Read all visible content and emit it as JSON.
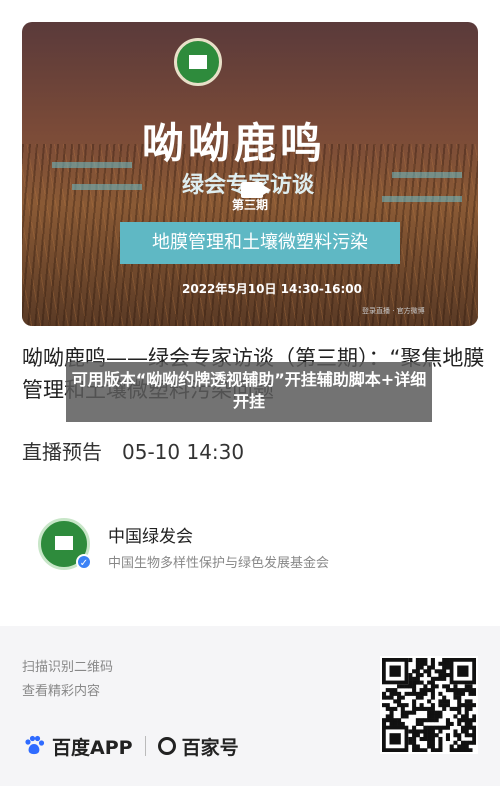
{
  "cover": {
    "title_art": "呦呦鹿鸣",
    "subtitle": "绿会专家访谈",
    "episode": "第三期",
    "topic": "地膜管理和土壤微塑料污染",
    "datetime": "2022年5月10日 14:30-16:00",
    "tiny_text": "登录直播 · 官方微博"
  },
  "headline": "呦呦鹿鸣——绿会专家访谈（第三期）：“聚焦地膜管理和土壤微塑料污染问题",
  "overlay_text": "可用版本“呦呦约牌透视辅助”开挂辅助脚本+详细开挂",
  "schedule": {
    "label": "直播预告",
    "time": "05-10 14:30"
  },
  "org": {
    "name": "中国绿发会",
    "description": "中国生物多样性保护与绿色发展基金会",
    "verified_mark": "✓"
  },
  "footer": {
    "scan_line1": "扫描识别二维码",
    "scan_line2": "查看精彩内容",
    "app_name": "百度APP",
    "hao_name": "百家号"
  },
  "colors": {
    "topic_bg": "#5fb8c4",
    "logo_green": "#2e8b3c",
    "verified_blue": "#3b82f6",
    "paw_blue": "#2f6bff"
  },
  "icons": [
    "video-icon",
    "verified-icon",
    "baidu-paw-icon",
    "baijiahao-icon",
    "qr-code"
  ]
}
